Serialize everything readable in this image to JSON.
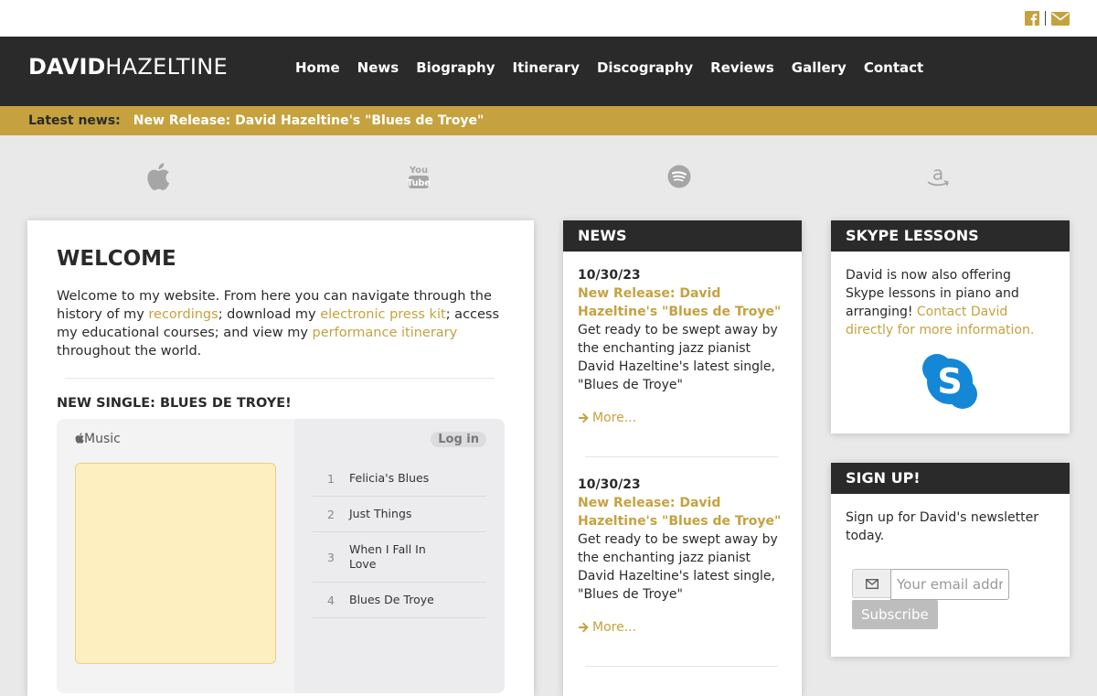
{
  "social": {
    "icons": [
      "facebook-icon",
      "mail-icon"
    ],
    "color": "#c5a23f"
  },
  "brand": {
    "first": "DAVID",
    "last": "HAZELTINE"
  },
  "nav": [
    "Home",
    "News",
    "Biography",
    "Itinerary",
    "Discography",
    "Reviews",
    "Gallery",
    "Contact"
  ],
  "ticker": {
    "label": "Latest news:",
    "item": "New Release: David Hazeltine's \"Blues de Troye\""
  },
  "services": [
    "apple-icon",
    "youtube-icon",
    "spotify-icon",
    "amazon-icon"
  ],
  "welcome": {
    "title": "WELCOME",
    "intro_1": "Welcome to my website. From here you can navigate through the history of my ",
    "link_recordings": "recordings",
    "intro_2": "; download my ",
    "link_presskit": "electronic press kit",
    "intro_3": "; access my educational courses; and view my ",
    "link_itinerary": "performance itinerary",
    "intro_4": " throughout the world.",
    "single_heading": "NEW SINGLE: BLUES DE TROYE!"
  },
  "player": {
    "brand": "Music",
    "login": "Log in",
    "tracks": [
      {
        "n": "1",
        "title": "Felicia's Blues"
      },
      {
        "n": "2",
        "title": "Just Things"
      },
      {
        "n": "3",
        "title": "When I Fall In Love"
      },
      {
        "n": "4",
        "title": "Blues De Troye"
      }
    ]
  },
  "news": {
    "heading": "NEWS",
    "items": [
      {
        "date": "10/30/23",
        "title": "New Release: David Hazeltine's \"Blues de Troye\"",
        "body": "Get ready to be swept away by the enchanting jazz pianist David Hazeltine's latest single, \"Blues de Troye\"",
        "more": "More..."
      },
      {
        "date": "10/30/23",
        "title": "New Release: David Hazeltine's \"Blues de Troye\"",
        "body": "Get ready to be swept away by the enchanting jazz pianist David Hazeltine's latest single, \"Blues de Troye\"",
        "more": "More..."
      }
    ]
  },
  "skype": {
    "heading": "SKYPE LESSONS",
    "text": "David is now also offering Skype lessons in piano and arranging! ",
    "link": "Contact David directly for more information."
  },
  "signup": {
    "heading": "SIGN UP!",
    "text": "Sign up for David's newsletter today.",
    "placeholder": "Your email address",
    "button": "Subscribe"
  },
  "colors": {
    "accent": "#c5a23f",
    "dark": "#2a2a2a",
    "skype": "#1487d7"
  }
}
